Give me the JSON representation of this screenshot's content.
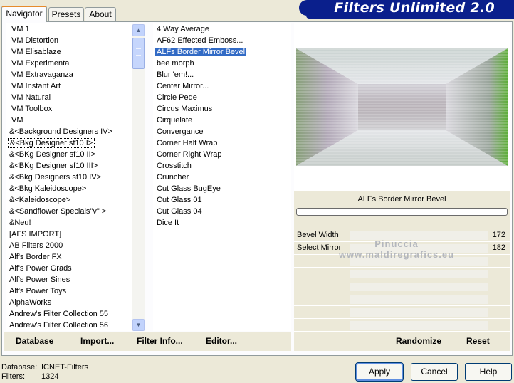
{
  "app": {
    "title": "Filters Unlimited 2.0"
  },
  "tabs": [
    {
      "label": "Navigator",
      "active": true
    },
    {
      "label": "Presets",
      "active": false
    },
    {
      "label": "About",
      "active": false
    }
  ],
  "categories": [
    "VM 1",
    "VM Distortion",
    "VM Elisablaze",
    "VM Experimental",
    "VM Extravaganza",
    "VM Instant Art",
    "VM Natural",
    "VM Toolbox",
    "VM",
    "&<Background Designers IV>",
    "&<Bkg Designer sf10 I>",
    "&<BKg Designer sf10 II>",
    "&<BKg Designer sf10 III>",
    "&<Bkg Designers sf10 IV>",
    "&<Bkg Kaleidoscope>",
    "&<Kaleidoscope>",
    "&<Sandflower Specials\"v\" >",
    "&Neu!",
    "[AFS IMPORT]",
    "AB Filters 2000",
    "Alf's Border FX",
    "Alf's Power Grads",
    "Alf's Power Sines",
    "Alf's Power Toys",
    "AlphaWorks",
    "Andrew's Filter Collection 55",
    "Andrew's Filter Collection 56"
  ],
  "categories_indent_count": 9,
  "categories_selected_index": 10,
  "filters": [
    "4 Way Average",
    "AF62 Effected Emboss...",
    "ALFs Border Mirror Bevel",
    "bee morph",
    "Blur 'em!...",
    "Center Mirror...",
    "Circle Pede",
    "Circus Maximus",
    "Cirquelate",
    "Convergance",
    "Corner Half Wrap",
    "Corner Right Wrap",
    "Crosstitch",
    "Cruncher",
    "Cut Glass  BugEye",
    "Cut Glass 01",
    "Cut Glass 04",
    "Dice It"
  ],
  "filters_selected_index": 2,
  "preview": {
    "filter_name": "ALFs Border Mirror Bevel",
    "progress": 0,
    "accent_green": "#5fae3a"
  },
  "params": [
    {
      "name": "Bevel Width",
      "value": "172"
    },
    {
      "name": "Select Mirror",
      "value": "182"
    },
    {
      "name": "",
      "value": ""
    },
    {
      "name": "",
      "value": ""
    },
    {
      "name": "",
      "value": ""
    },
    {
      "name": "",
      "value": ""
    },
    {
      "name": "",
      "value": ""
    },
    {
      "name": "",
      "value": ""
    }
  ],
  "watermark": {
    "line1": "Pinuccia",
    "line2": "www.maldiregrafics.eu"
  },
  "bottom_links": {
    "database": "Database",
    "import": "Import...",
    "filter_info": "Filter Info...",
    "editor": "Editor...",
    "randomize": "Randomize",
    "reset": "Reset"
  },
  "status": {
    "database_label": "Database:",
    "database_value": "ICNET-Filters",
    "filters_label": "Filters:",
    "filters_value": "1324"
  },
  "buttons": {
    "apply": "Apply",
    "cancel": "Cancel",
    "help": "Help"
  },
  "scrollbar": {
    "up_icon": "chevron-up-icon",
    "down_icon": "chevron-down-icon"
  }
}
